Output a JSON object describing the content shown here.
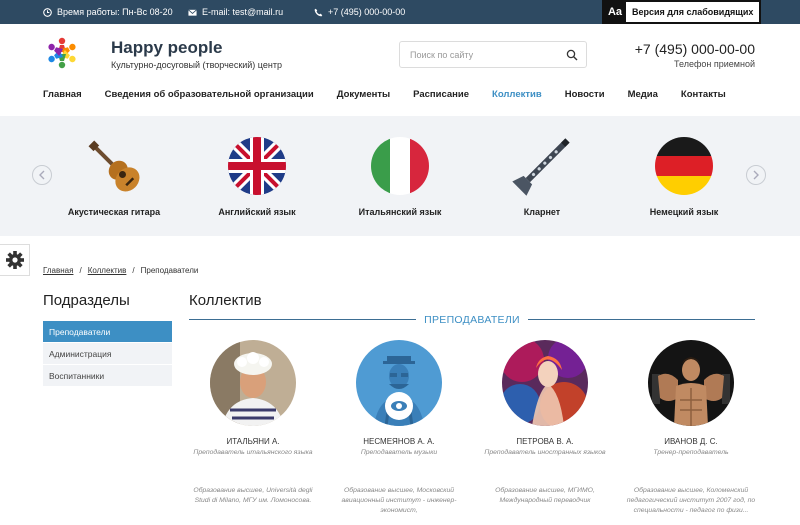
{
  "topbar": {
    "hours": "Время работы: Пн-Вс 08-20",
    "email": "E-mail: test@mail.ru",
    "phone": "+7 (495) 000-00-00",
    "vision_aa": "Aa",
    "vision_label": "Версия для слабовидящих"
  },
  "header": {
    "brand": "Happy people",
    "tagline": "Культурно-досуговый (творческий) центр",
    "search_placeholder": "Поиск по сайту",
    "phone": "+7 (495) 000-00-00",
    "phone_label": "Телефон приемной"
  },
  "nav": {
    "items": [
      {
        "label": "Главная"
      },
      {
        "label": "Сведения об образовательной организации"
      },
      {
        "label": "Документы"
      },
      {
        "label": "Расписание"
      },
      {
        "label": "Коллектив"
      },
      {
        "label": "Новости"
      },
      {
        "label": "Медиа"
      },
      {
        "label": "Контакты"
      }
    ],
    "active": "Коллектив"
  },
  "carousel": {
    "slides": [
      {
        "label": "Акустическая гитара",
        "icon": "guitar-icon"
      },
      {
        "label": "Английский язык",
        "icon": "uk-flag-icon"
      },
      {
        "label": "Итальянский язык",
        "icon": "italy-flag-icon"
      },
      {
        "label": "Кларнет",
        "icon": "clarinet-icon"
      },
      {
        "label": "Немецкий язык",
        "icon": "germany-flag-icon"
      }
    ],
    "prev_icon": "chevron-left-icon",
    "next_icon": "chevron-right-icon"
  },
  "breadcrumb": {
    "items": [
      "Главная",
      "Коллектив",
      "Преподаватели"
    ],
    "separator": "/"
  },
  "sidebar": {
    "title": "Подразделы",
    "items": [
      {
        "label": "Преподаватели",
        "active": true
      },
      {
        "label": "Администрация",
        "active": false
      },
      {
        "label": "Воспитанники",
        "active": false
      }
    ]
  },
  "main": {
    "title": "Коллектив",
    "section": "ПРЕПОДАВАТЕЛИ",
    "people": [
      {
        "name": "ИТАЛЬЯНИ А.",
        "role": "Преподаватель итальянского языка",
        "bio": "Образование высшее, Università degli Studi di Milano, МГУ им. Ломоносова."
      },
      {
        "name": "НЕСМЕЯНОВ А. А.",
        "role": "Преподаватель музыки",
        "bio": "Образование высшее, Московский авиационный институт - инженер-экономист,"
      },
      {
        "name": "ПЕТРОВА В. А.",
        "role": "Преподаватель иностранных языков",
        "bio": "Образование высшее, МГИМО, Международный переводчик"
      },
      {
        "name": "ИВАНОВ Д. С.",
        "role": "Тренер-преподаватель",
        "bio": "Образование высшее, Коломенский педагогический институт 2007 год, по специальности - педагог по физи..."
      }
    ]
  },
  "colors": {
    "topbar": "#2e4a62",
    "accent": "#3d8fc4",
    "carousel_bg": "#f1f3f6"
  }
}
